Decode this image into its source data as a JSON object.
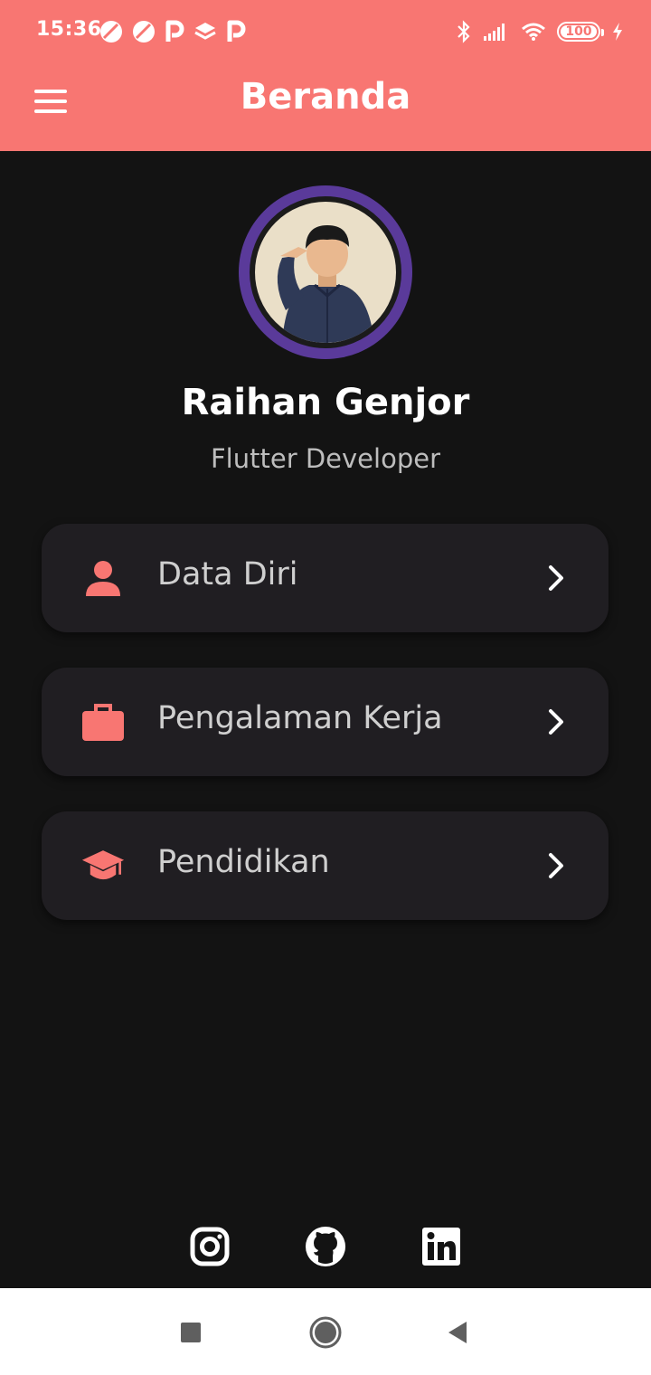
{
  "status_bar": {
    "time": "15:36",
    "battery": "100",
    "left_icons": [
      "opera-icon",
      "opera-icon",
      "p-icon",
      "layers-icon",
      "p-icon"
    ],
    "right_icons": [
      "bluetooth-icon",
      "signal-icon",
      "wifi-icon",
      "battery-icon",
      "charging-icon"
    ]
  },
  "app_bar": {
    "title": "Beranda",
    "menu_icon": "hamburger-menu-icon"
  },
  "profile": {
    "name": "Raihan Genjor",
    "role": "Flutter Developer"
  },
  "menu": {
    "items": [
      {
        "label": "Data Diri",
        "icon": "person-icon"
      },
      {
        "label": "Pengalaman Kerja",
        "icon": "briefcase-icon"
      },
      {
        "label": "Pendidikan",
        "icon": "graduation-cap-icon"
      }
    ]
  },
  "social": [
    "instagram-icon",
    "github-icon",
    "linkedin-icon"
  ],
  "colors": {
    "accent": "#F87672",
    "background": "#131313",
    "card": "#201E22",
    "avatar_ring": "#5A3A9A"
  }
}
